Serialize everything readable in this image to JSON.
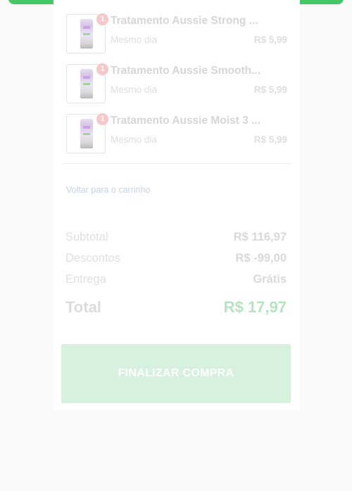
{
  "cart": {
    "items": [
      {
        "name": "Tratamento Aussie Strong ...",
        "quantity": "1",
        "delivery": "Mesmo dia",
        "price": "R$ 5,99"
      },
      {
        "name": "Tratamento Aussie Smooth...",
        "quantity": "1",
        "delivery": "Mesmo dia",
        "price": "R$ 5,99"
      },
      {
        "name": "Tratamento Aussie Moist 3 ...",
        "quantity": "1",
        "delivery": "Mesmo dia",
        "price": "R$ 5,99"
      }
    ],
    "back_link": "Voltar para o carrinho"
  },
  "summary": {
    "subtotal_label": "Subtotal",
    "subtotal_value": "R$ 116,97",
    "discounts_label": "Descontos",
    "discounts_value": "R$ -99,00",
    "delivery_label": "Entrega",
    "delivery_value": "Grátis",
    "total_label": "Total",
    "total_value": "R$ 17,97"
  },
  "checkout": {
    "button_label": "FINALIZAR COMPRA"
  },
  "colors": {
    "accent": "#44c767",
    "button_bg": "#d6f2de"
  }
}
